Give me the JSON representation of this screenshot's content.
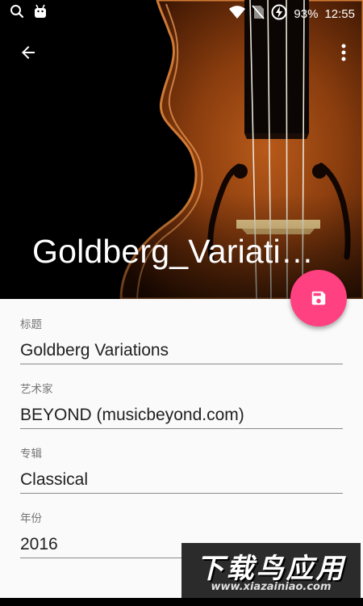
{
  "status_bar": {
    "battery_text": "93%",
    "time": "12:55",
    "icons": [
      "search-icon",
      "android-icon",
      "wifi-icon",
      "no-sim-icon",
      "battery-charging-icon"
    ]
  },
  "toolbar": {
    "back_icon": "arrow-back-icon",
    "more_icon": "more-vert-icon"
  },
  "header": {
    "title": "Goldberg_Variations"
  },
  "fab": {
    "icon": "save-icon",
    "color": "#ff4081"
  },
  "form": {
    "fields": [
      {
        "label": "标题",
        "value": "Goldberg Variations"
      },
      {
        "label": "艺术家",
        "value": "BEYOND (musicbeyond.com)"
      },
      {
        "label": "专辑",
        "value": "Classical"
      },
      {
        "label": "年份",
        "value": "2016"
      }
    ]
  },
  "watermark": {
    "title": "下载鸟应用",
    "url": "www.xiazainiao.com"
  },
  "colors": {
    "accent": "#ff4081",
    "background": "#fafafa",
    "label": "#757575",
    "text": "#212121"
  }
}
